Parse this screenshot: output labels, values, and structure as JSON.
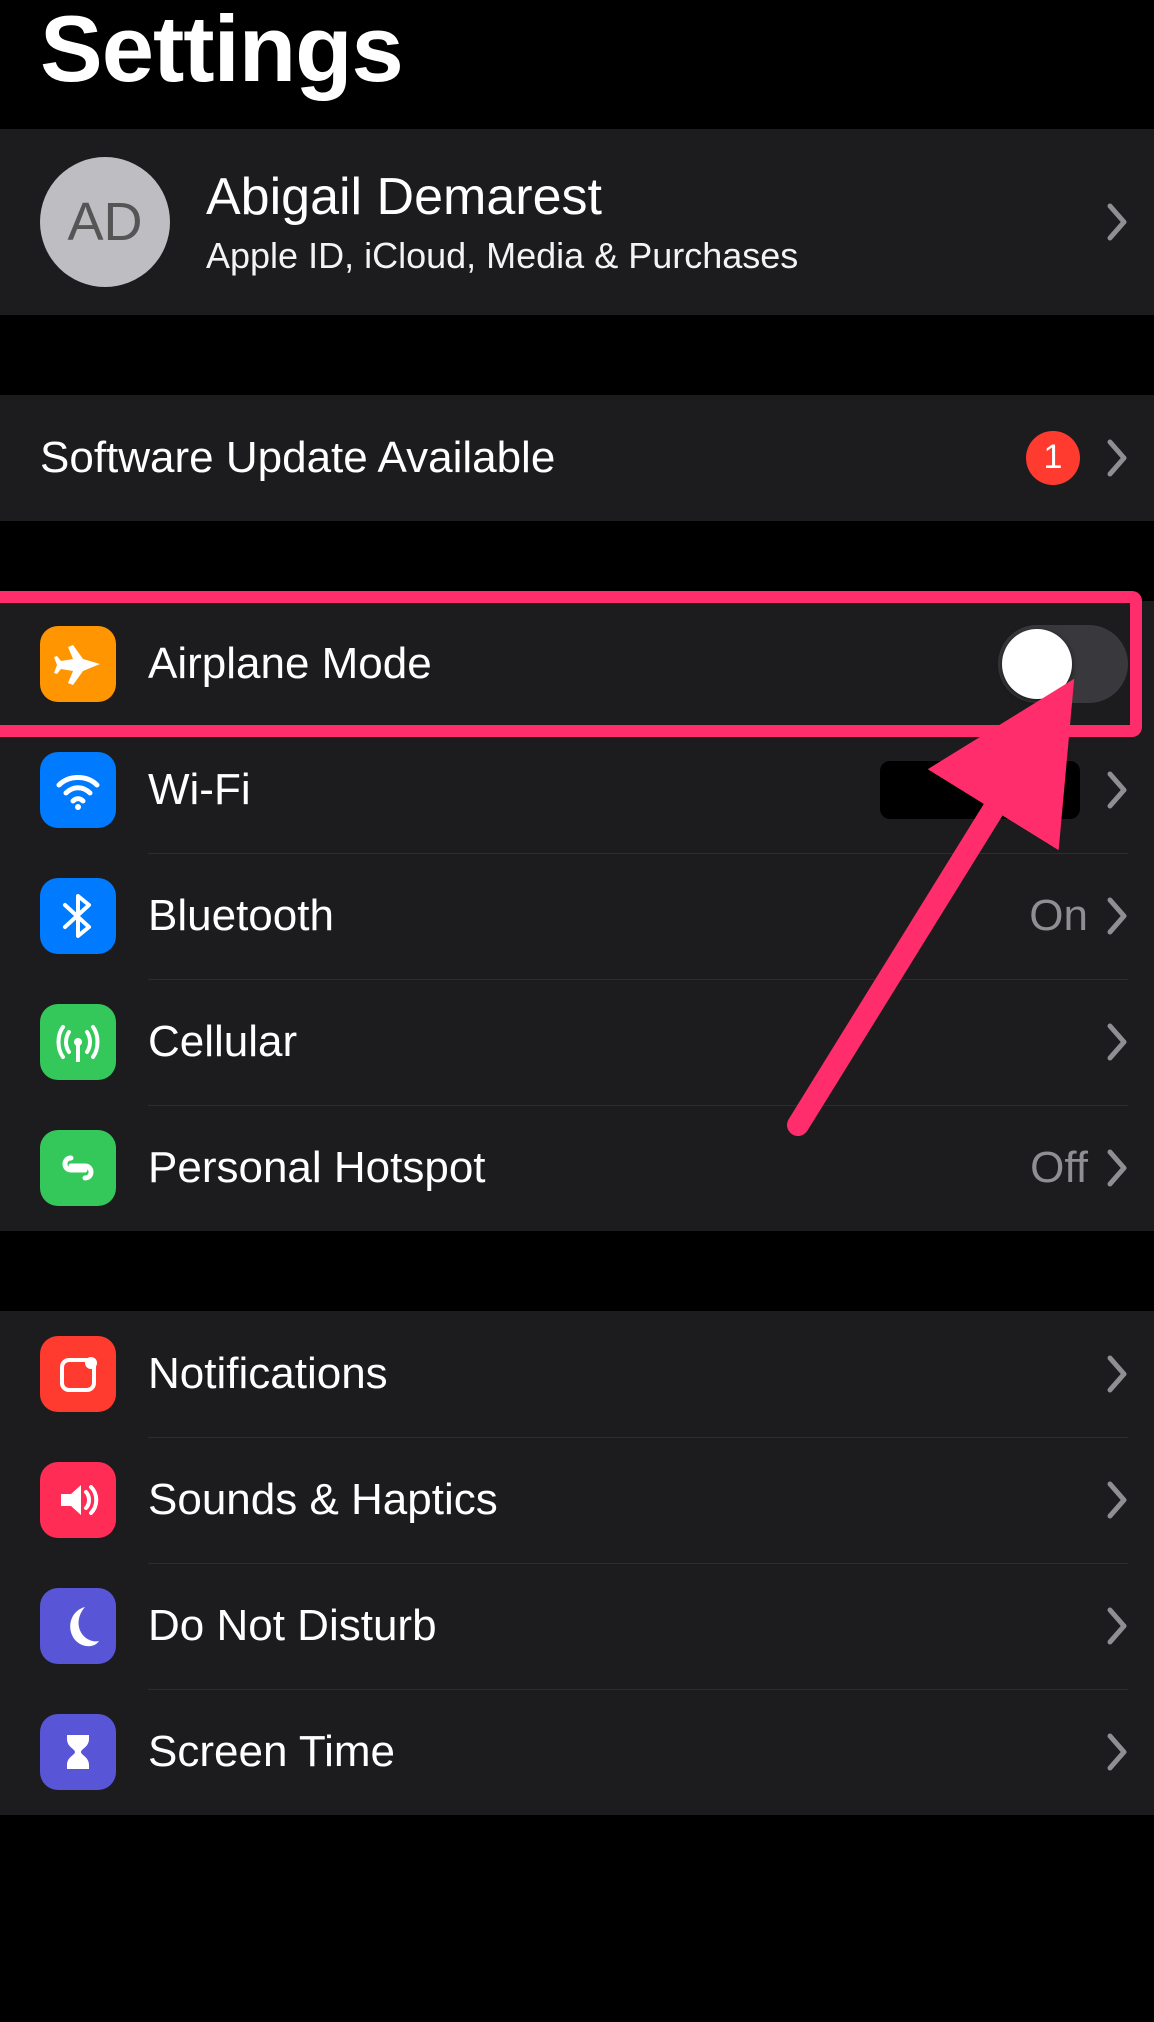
{
  "title": "Settings",
  "profile": {
    "initials": "AD",
    "name": "Abigail Demarest",
    "subtitle": "Apple ID, iCloud, Media & Purchases"
  },
  "software_update": {
    "label": "Software Update Available",
    "badge": "1"
  },
  "connectivity": {
    "airplane": {
      "label": "Airplane Mode",
      "on": false
    },
    "wifi": {
      "label": "Wi-Fi",
      "value_redacted": true
    },
    "bluetooth": {
      "label": "Bluetooth",
      "value": "On"
    },
    "cellular": {
      "label": "Cellular"
    },
    "hotspot": {
      "label": "Personal Hotspot",
      "value": "Off"
    }
  },
  "general": {
    "notifications": {
      "label": "Notifications"
    },
    "sounds": {
      "label": "Sounds & Haptics"
    },
    "dnd": {
      "label": "Do Not Disturb"
    },
    "screentime": {
      "label": "Screen Time"
    }
  },
  "annotation": {
    "highlight_target": "airplane-mode-row",
    "arrow_points_to": "airplane-mode-toggle"
  },
  "colors": {
    "orange": "#ff9500",
    "blue": "#007aff",
    "green": "#34c759",
    "red": "#ff3b30",
    "pink": "#ff2d55",
    "purple": "#5856d6",
    "annotation": "#ff2d6b"
  }
}
